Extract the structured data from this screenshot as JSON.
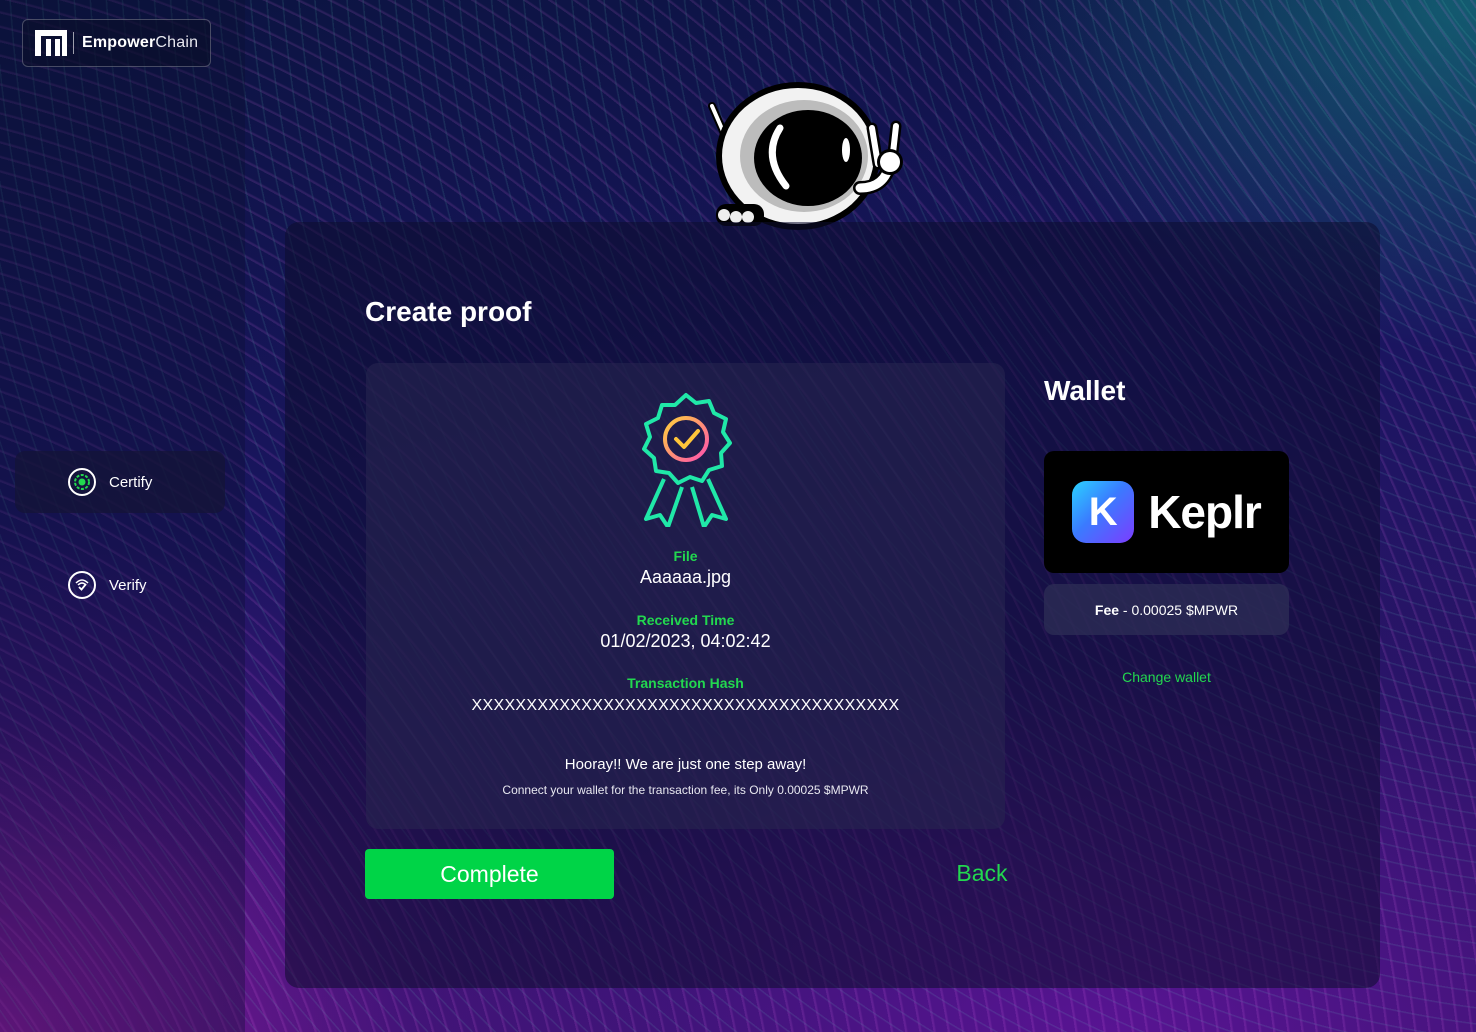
{
  "brand": {
    "name_bold": "Empower",
    "name_light": "Chain"
  },
  "sidebar": {
    "items": [
      {
        "label": "Certify",
        "active": true,
        "icon": "certify-icon"
      },
      {
        "label": "Verify",
        "active": false,
        "icon": "verify-icon"
      }
    ]
  },
  "main": {
    "title": "Create proof",
    "proof": {
      "file_label": "File",
      "file_value": "Aaaaaa.jpg",
      "time_label": "Received Time",
      "time_value": "01/02/2023, 04:02:42",
      "hash_label": "Transaction Hash",
      "hash_value": "XXXXXXXXXXXXXXXXXXXXXXXXXXXXXXXXXXXXXXX",
      "message": "Hooray!! We are just one step away!",
      "submessage": "Connect your wallet for the transaction fee, its Only 0.00025 $MPWR"
    },
    "complete_label": "Complete",
    "back_label": "Back"
  },
  "wallet": {
    "title": "Wallet",
    "provider_letter": "K",
    "provider_name": "Keplr",
    "fee_label": "Fee",
    "fee_value": " - 0.00025 $MPWR",
    "change_label": "Change wallet"
  },
  "colors": {
    "accent": "#00d447",
    "accent_text": "#22d84f",
    "card": "#0c0c2d"
  }
}
